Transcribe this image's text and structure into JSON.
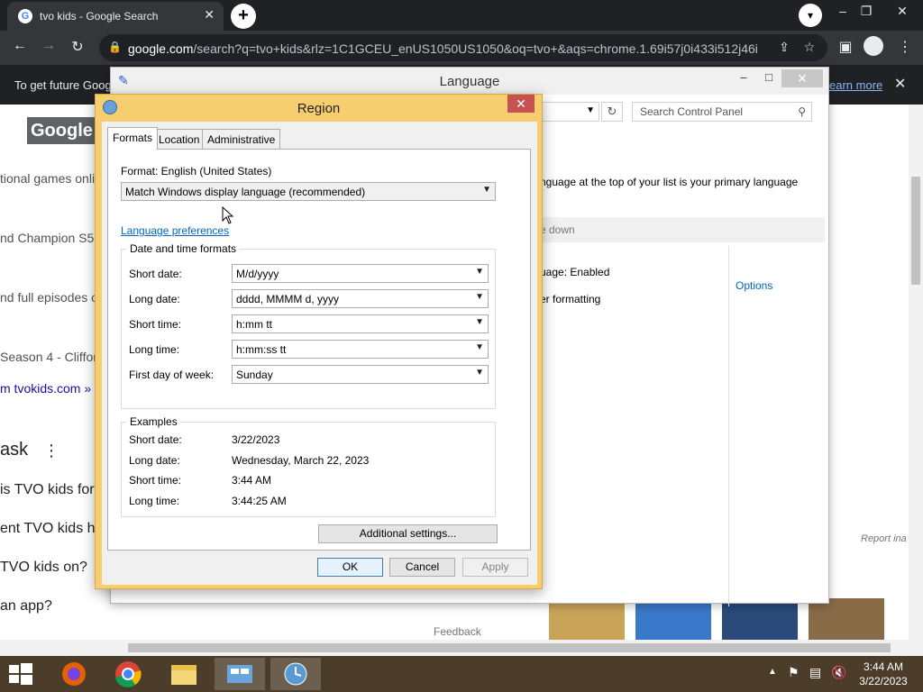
{
  "browser": {
    "tab_title": "tvo kids - Google Search",
    "url_host": "google.com",
    "url_rest": "/search?q=tvo+kids&rlz=1C1GCEU_enUS1050US1050&oq=tvo+&aqs=chrome.1.69i57j0i433i512j46i...",
    "info_text": "To get future Goog",
    "info_link": "earn more"
  },
  "page": {
    "logo": "Google",
    "snippets": [
      "tional games onli",
      "nd Champion S5",
      "nd full episodes o",
      "Season 4 - Cliffor",
      "m tvokids.com »",
      "ask",
      "is TVO kids for",
      "ent TVO kids h",
      "TVO kids on?",
      "an app?"
    ],
    "feedback": "Feedback",
    "report": "Report ina"
  },
  "language_window": {
    "title": "Language",
    "search_placeholder": "Search Control Panel",
    "primary_text": "nguage at the top of your list is your primary language",
    "move_down": "e down",
    "status1": "uage: Enabled",
    "status2": "er formatting",
    "options": "Options"
  },
  "region": {
    "title": "Region",
    "tabs": [
      "Formats",
      "Location",
      "Administrative"
    ],
    "format_label": "Format: English (United States)",
    "format_value": "Match Windows display language (recommended)",
    "lang_prefs_link": "Language preferences",
    "dt_group": "Date and time formats",
    "fields": [
      {
        "label": "Short date:",
        "value": "M/d/yyyy"
      },
      {
        "label": "Long date:",
        "value": "dddd, MMMM d, yyyy"
      },
      {
        "label": "Short time:",
        "value": "h:mm tt"
      },
      {
        "label": "Long time:",
        "value": "h:mm:ss tt"
      },
      {
        "label": "First day of week:",
        "value": "Sunday"
      }
    ],
    "examples_group": "Examples",
    "examples": [
      {
        "label": "Short date:",
        "value": "3/22/2023"
      },
      {
        "label": "Long date:",
        "value": "Wednesday, March 22, 2023"
      },
      {
        "label": "Short time:",
        "value": "3:44 AM"
      },
      {
        "label": "Long time:",
        "value": "3:44:25 AM"
      }
    ],
    "additional": "Additional settings...",
    "ok": "OK",
    "cancel": "Cancel",
    "apply": "Apply"
  },
  "taskbar": {
    "time": "3:44 AM",
    "date": "3/22/2023"
  },
  "colors": {
    "dialog_frame": "#f7ce6f",
    "taskbar": "#4b3d2a",
    "link": "#0066cc"
  }
}
